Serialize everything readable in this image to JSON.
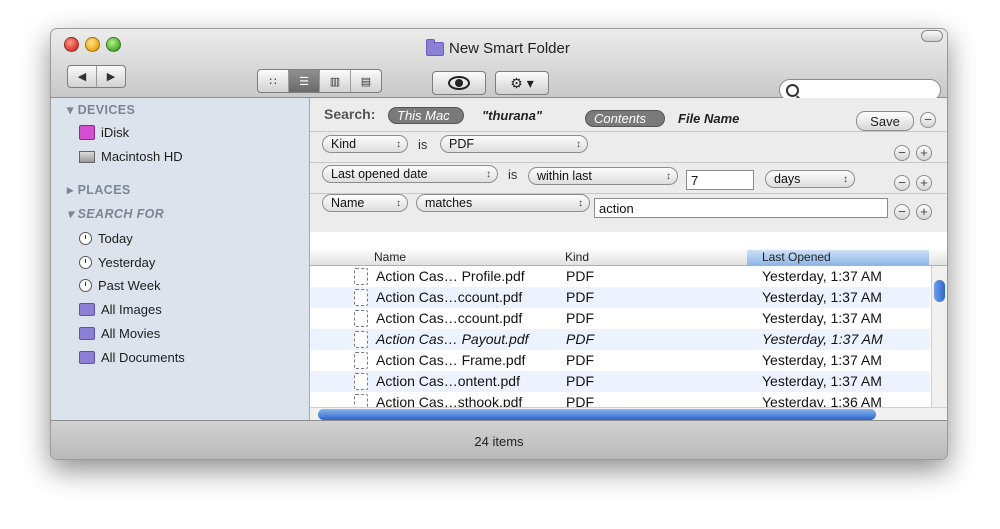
{
  "window": {
    "title": "New Smart Folder"
  },
  "toolbar": {
    "back_icon": "◀",
    "forward_icon": "▶",
    "view_icons": [
      "∷",
      "☰",
      "▥",
      "▤"
    ],
    "action_label": "⚙ ▾",
    "search_placeholder": ""
  },
  "sidebar": {
    "devices_label": "DEVICES",
    "devices": [
      "iDisk",
      "Macintosh HD"
    ],
    "places_label": "PLACES",
    "search_for_label": "SEARCH FOR",
    "search_for": [
      "Today",
      "Yesterday",
      "Past Week",
      "All Images",
      "All Movies",
      "All Documents"
    ]
  },
  "search": {
    "label": "Search:",
    "scope_this_mac": "This Mac",
    "scope_user": "\"thurana\"",
    "contents": "Contents",
    "file_name": "File Name",
    "save": "Save"
  },
  "criteria": [
    {
      "attr": "Kind",
      "op": "is",
      "value": "PDF"
    },
    {
      "attr": "Last opened date",
      "op": "is",
      "value": "within last",
      "number": "7",
      "unit": "days"
    },
    {
      "attr": "Name",
      "value": "matches",
      "text": "action"
    }
  ],
  "table": {
    "headers": [
      "Name",
      "Kind",
      "Last Opened"
    ],
    "rows": [
      {
        "name": "Action Cas… Profile.pdf",
        "kind": "PDF",
        "opened": "Yesterday, 1:37 AM"
      },
      {
        "name": "Action Cas…ccount.pdf",
        "kind": "PDF",
        "opened": "Yesterday, 1:37 AM"
      },
      {
        "name": "Action Cas…ccount.pdf",
        "kind": "PDF",
        "opened": "Yesterday, 1:37 AM"
      },
      {
        "name": "Action Cas… Payout.pdf",
        "kind": "PDF",
        "opened": "Yesterday, 1:37 AM"
      },
      {
        "name": "Action Cas… Frame.pdf",
        "kind": "PDF",
        "opened": "Yesterday, 1:37 AM"
      },
      {
        "name": "Action Cas…ontent.pdf",
        "kind": "PDF",
        "opened": "Yesterday, 1:37 AM"
      },
      {
        "name": "Action Cas…sthook.pdf",
        "kind": "PDF",
        "opened": "Yesterday, 1:36 AM"
      }
    ]
  },
  "status": "24 items"
}
